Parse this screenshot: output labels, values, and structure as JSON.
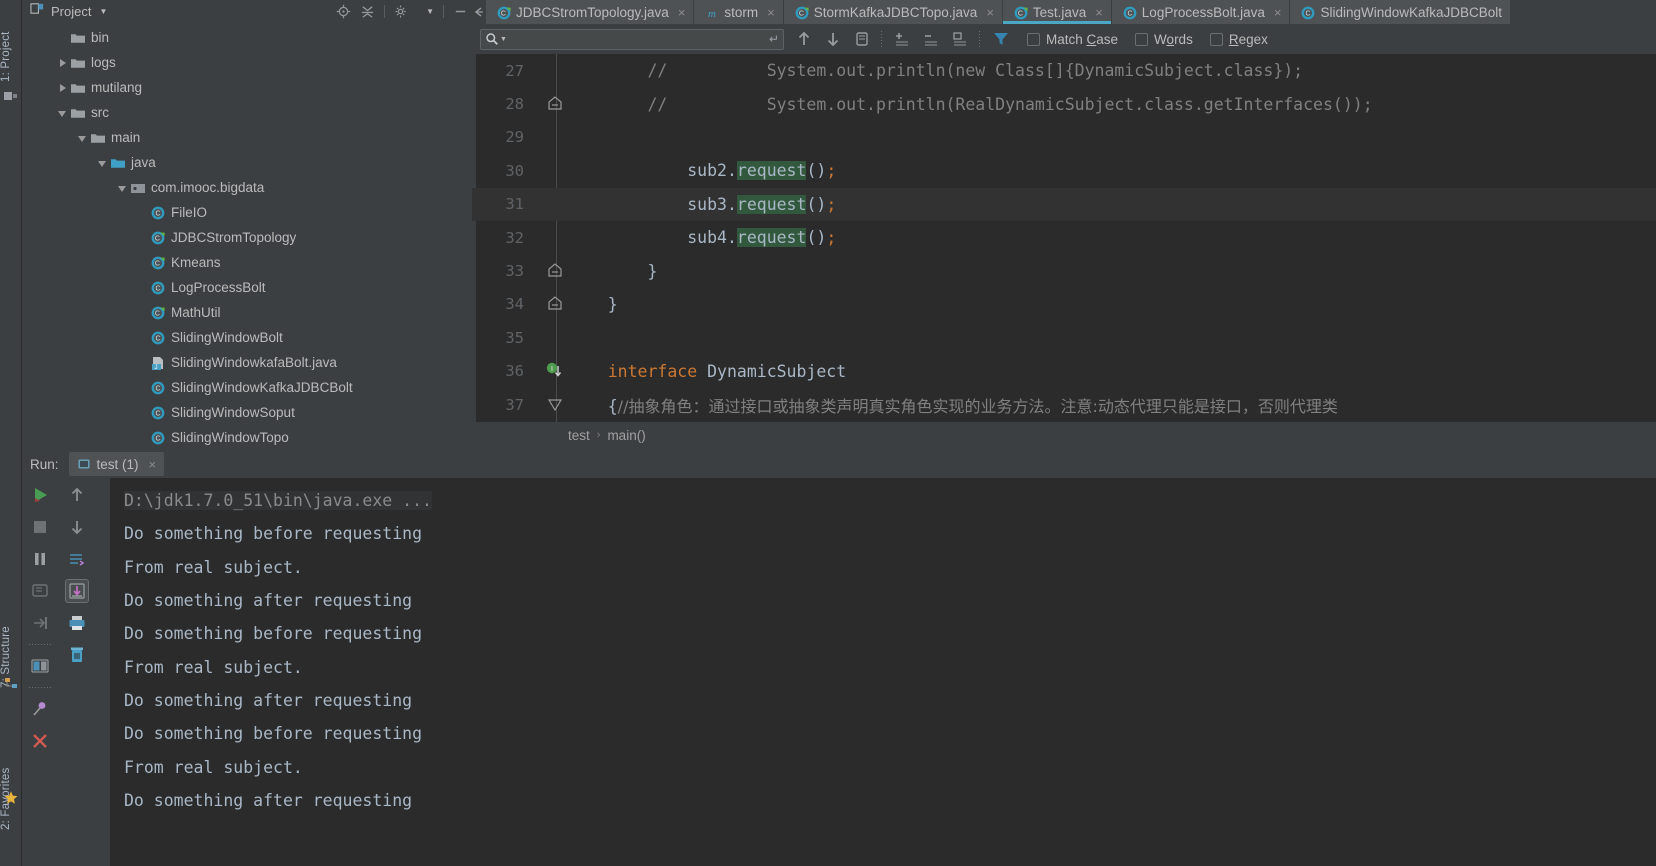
{
  "left_strip": {
    "project_label": "1: Project",
    "structure_label": "7: Structure",
    "favorites_label": "2: Favorites",
    "star_icon": "star-icon"
  },
  "project_panel": {
    "title": "Project",
    "caret_icon": "chevron-down-icon",
    "tools": [
      {
        "name": "locate-icon"
      },
      {
        "name": "collapse-all-icon"
      },
      {
        "name": "gear-icon"
      },
      {
        "name": "hide-icon"
      }
    ],
    "tree": [
      {
        "label": "bin",
        "depth": 1,
        "twisty": "none",
        "icon": "folder-icon"
      },
      {
        "label": "logs",
        "depth": 1,
        "twisty": "closed",
        "icon": "folder-icon"
      },
      {
        "label": "mutilang",
        "depth": 1,
        "twisty": "closed",
        "icon": "folder-icon"
      },
      {
        "label": "src",
        "depth": 1,
        "twisty": "open",
        "icon": "folder-icon"
      },
      {
        "label": "main",
        "depth": 2,
        "twisty": "open",
        "icon": "folder-icon"
      },
      {
        "label": "java",
        "depth": 3,
        "twisty": "open",
        "icon": "source-folder-icon"
      },
      {
        "label": "com.imooc.bigdata",
        "depth": 4,
        "twisty": "open",
        "icon": "package-icon"
      },
      {
        "label": "FileIO",
        "depth": 5,
        "twisty": "none",
        "icon": "java-class-icon"
      },
      {
        "label": "JDBCStromTopology",
        "depth": 5,
        "twisty": "none",
        "icon": "java-class-runnable-icon"
      },
      {
        "label": "Kmeans",
        "depth": 5,
        "twisty": "none",
        "icon": "java-class-runnable-icon"
      },
      {
        "label": "LogProcessBolt",
        "depth": 5,
        "twisty": "none",
        "icon": "java-class-icon"
      },
      {
        "label": "MathUtil",
        "depth": 5,
        "twisty": "none",
        "icon": "java-class-runnable-icon"
      },
      {
        "label": "SlidingWindowBolt",
        "depth": 5,
        "twisty": "none",
        "icon": "java-class-icon"
      },
      {
        "label": "SlidingWindowkafaBolt.java",
        "depth": 5,
        "twisty": "none",
        "icon": "java-file-icon"
      },
      {
        "label": "SlidingWindowKafkaJDBCBolt",
        "depth": 5,
        "twisty": "none",
        "icon": "java-class-icon"
      },
      {
        "label": "SlidingWindowSoput",
        "depth": 5,
        "twisty": "none",
        "icon": "java-class-icon"
      },
      {
        "label": "SlidingWindowTopo",
        "depth": 5,
        "twisty": "none",
        "icon": "java-class-icon"
      }
    ]
  },
  "editor_tabs": {
    "scroll_icon": "tab-scroll-icon",
    "items": [
      {
        "label": "JDBCStromTopology.java",
        "icon": "java-class-runnable-icon",
        "active": false,
        "close": "×"
      },
      {
        "label": "storm",
        "icon": "maven-module-icon",
        "active": false,
        "close": "×"
      },
      {
        "label": "StormKafkaJDBCTopo.java",
        "icon": "java-class-runnable-icon",
        "active": false,
        "close": "×"
      },
      {
        "label": "Test.java",
        "icon": "java-class-runnable-icon",
        "active": true,
        "close": "×"
      },
      {
        "label": "LogProcessBolt.java",
        "icon": "java-class-icon",
        "active": false,
        "close": "×"
      },
      {
        "label": "SlidingWindowKafkaJDBCBolt",
        "icon": "java-class-icon",
        "active": false,
        "close": ""
      }
    ]
  },
  "findbar": {
    "search_value": "",
    "search_placeholder": "",
    "search_icon": "magnifier-icon",
    "search_dropdown_icon": "chevron-down-icon",
    "enter_icon": "enter-arrow-icon",
    "buttons": [
      {
        "name": "find-previous-icon"
      },
      {
        "name": "find-next-icon"
      },
      {
        "name": "select-all-occurrences-icon"
      },
      {
        "name": "add-line-icon"
      },
      {
        "name": "remove-line-icon"
      },
      {
        "name": "exclude-line-icon"
      },
      {
        "name": "filter-icon"
      }
    ],
    "checkboxes": [
      {
        "label": "Match Case",
        "mnemonic": "C",
        "checked": false
      },
      {
        "label": "Words",
        "mnemonic": "o",
        "checked": false
      },
      {
        "label": "Regex",
        "mnemonic": "R",
        "checked": false
      }
    ]
  },
  "code": {
    "lines": [
      {
        "no": "27",
        "current": false,
        "fold": "none",
        "tokens": [
          {
            "t": "        ",
            "c": "plain"
          },
          {
            "t": "//          System.out.println(new Class[]{DynamicSubject.class});",
            "c": "cmt"
          }
        ]
      },
      {
        "no": "28",
        "current": false,
        "fold": "end",
        "tokens": [
          {
            "t": "        ",
            "c": "plain"
          },
          {
            "t": "//          System.out.println(RealDynamicSubject.class.getInterfaces());",
            "c": "cmt"
          }
        ]
      },
      {
        "no": "29",
        "current": false,
        "fold": "none",
        "tokens": []
      },
      {
        "no": "30",
        "current": false,
        "fold": "none",
        "tokens": [
          {
            "t": "            sub2.",
            "c": "plain"
          },
          {
            "t": "request",
            "c": "hit"
          },
          {
            "t": "()",
            "c": "plain"
          },
          {
            "t": ";",
            "c": "semi"
          }
        ]
      },
      {
        "no": "31",
        "current": true,
        "fold": "none",
        "tokens": [
          {
            "t": "            sub3.",
            "c": "plain"
          },
          {
            "t": "request",
            "c": "hit"
          },
          {
            "t": "()",
            "c": "plain"
          },
          {
            "t": ";",
            "c": "semi"
          }
        ]
      },
      {
        "no": "32",
        "current": false,
        "fold": "none",
        "tokens": [
          {
            "t": "            sub4.",
            "c": "plain"
          },
          {
            "t": "request",
            "c": "hit"
          },
          {
            "t": "()",
            "c": "plain"
          },
          {
            "t": ";",
            "c": "semi"
          }
        ]
      },
      {
        "no": "33",
        "current": false,
        "fold": "end",
        "tokens": [
          {
            "t": "        }",
            "c": "plain"
          }
        ]
      },
      {
        "no": "34",
        "current": false,
        "fold": "end",
        "tokens": [
          {
            "t": "    }",
            "c": "plain"
          }
        ]
      },
      {
        "no": "35",
        "current": false,
        "fold": "none",
        "tokens": []
      },
      {
        "no": "36",
        "current": false,
        "fold": "impl",
        "tokens": [
          {
            "t": "    ",
            "c": "plain"
          },
          {
            "t": "interface",
            "c": "kw"
          },
          {
            "t": " DynamicSubject",
            "c": "plain"
          }
        ]
      },
      {
        "no": "37",
        "current": false,
        "fold": "start",
        "tokens": [
          {
            "t": "    {",
            "c": "plain"
          },
          {
            "t": "//抽象角色：通过接口或抽象类声明真实角色实现的业务方法。注意:动态代理只能是接口，否则代理类",
            "c": "cjk"
          }
        ]
      }
    ]
  },
  "breadcrumb": {
    "items": [
      "test",
      "main()"
    ],
    "separator": "›"
  },
  "run_panel": {
    "label": "Run:",
    "tab_label": "test (1)",
    "tab_icon": "run-configuration-icon",
    "tab_close": "×",
    "gutter_left": [
      {
        "name": "run-icon"
      },
      {
        "name": "stop-icon"
      },
      {
        "name": "pause-icon"
      },
      {
        "name": "rerun-failed-icon"
      },
      {
        "name": "resume-program-icon"
      },
      {
        "name": "toggle-view-icon"
      },
      {
        "name": "pin-tab-icon"
      },
      {
        "name": "close-icon"
      }
    ],
    "gutter_right": [
      {
        "name": "scroll-up-icon"
      },
      {
        "name": "scroll-down-icon"
      },
      {
        "name": "soft-wrap-icon"
      },
      {
        "name": "scroll-to-end-icon",
        "selected": true
      },
      {
        "name": "print-icon"
      },
      {
        "name": "clear-all-icon"
      }
    ],
    "console_lines": [
      {
        "text": "D:\\jdk1.7.0_51\\bin\\java.exe ...",
        "dim": true
      },
      {
        "text": "Do something before requesting",
        "dim": false
      },
      {
        "text": "From real subject.",
        "dim": false
      },
      {
        "text": "Do something after requesting",
        "dim": false
      },
      {
        "text": "Do something before requesting",
        "dim": false
      },
      {
        "text": "From real subject.",
        "dim": false
      },
      {
        "text": "Do something after requesting",
        "dim": false
      },
      {
        "text": "Do something before requesting",
        "dim": false
      },
      {
        "text": "From real subject.",
        "dim": false
      },
      {
        "text": "Do something after requesting",
        "dim": false
      }
    ]
  },
  "colors": {
    "panel_bg": "#3c3f41",
    "editor_bg": "#2b2b2b",
    "accent": "#4aa8c4",
    "text": "#bbbbbb",
    "code_text": "#a9b7c6",
    "keyword": "#cc7832",
    "comment": "#808080",
    "search_highlight": "#32593d",
    "run_green": "#499c54"
  }
}
